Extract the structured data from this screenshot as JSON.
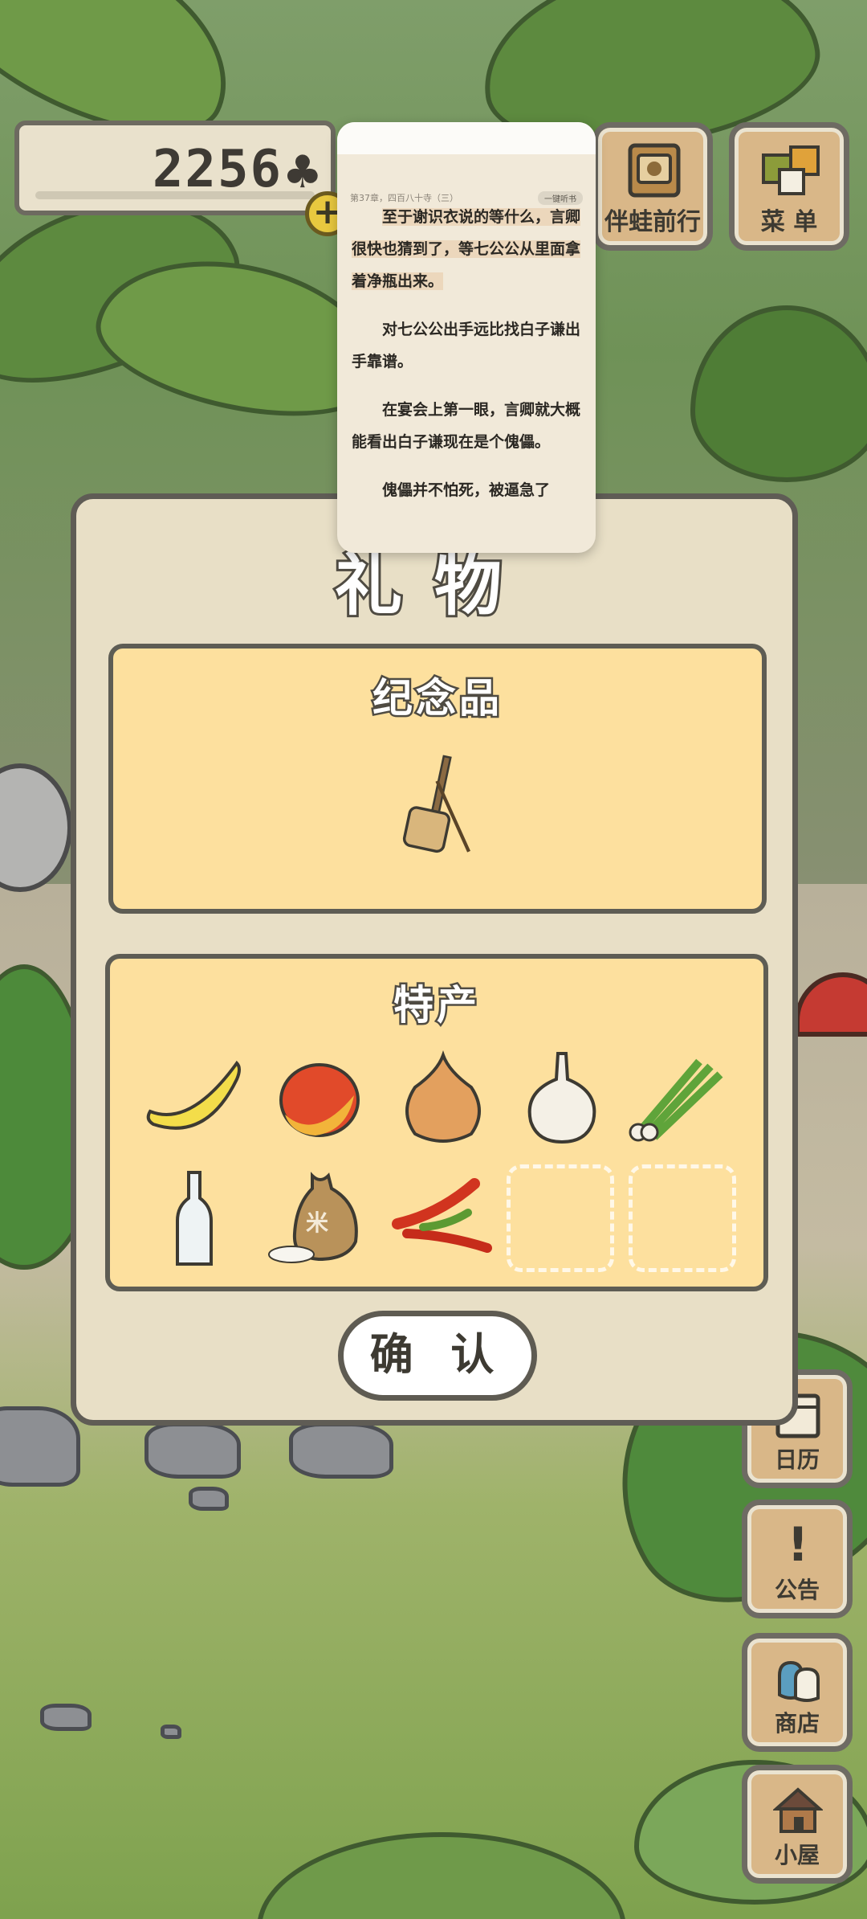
{
  "hud": {
    "clover_count": "2256",
    "clover_icon": "clover-icon",
    "plus_icon": "plus-icon"
  },
  "top_buttons": [
    {
      "label": "伴蛙前行",
      "icon": "album-icon"
    },
    {
      "label": "菜 单",
      "icon": "menu-icon"
    }
  ],
  "side_buttons": [
    {
      "label": "日历",
      "icon": "calendar-icon"
    },
    {
      "label": "公告",
      "icon": "exclamation-icon",
      "glyph": "!"
    },
    {
      "label": "商店",
      "icon": "bags-icon"
    },
    {
      "label": "小屋",
      "icon": "house-icon"
    }
  ],
  "dialog": {
    "title": "礼物",
    "souvenir": {
      "title": "纪念品",
      "items": [
        {
          "name": "sanshin-icon"
        }
      ]
    },
    "specialty": {
      "title": "特产",
      "items": [
        {
          "name": "banana-icon"
        },
        {
          "name": "mango-icon"
        },
        {
          "name": "onion-icon"
        },
        {
          "name": "garlic-icon"
        },
        {
          "name": "green-onion-icon"
        },
        {
          "name": "bottle-icon"
        },
        {
          "name": "rice-sack-icon",
          "label": "米"
        },
        {
          "name": "chili-pepper-icon"
        }
      ],
      "empty_slots": 2
    },
    "confirm_label": "确 认"
  },
  "reader": {
    "chapter": "第37章，四百八十寺（三）",
    "pill": "一键听书",
    "paragraphs": [
      {
        "text": "至于谢识衣说的等什么，言卿很快也猜到了，等七公公从里面拿着净瓶出来。",
        "highlight": true
      },
      {
        "text": "对七公公出手远比找白子谦出手靠谱。"
      },
      {
        "text": "在宴会上第一眼，言卿就大概能看出白子谦现在是个傀儡。"
      },
      {
        "text": "傀儡并不怕死，被逼急了"
      }
    ]
  },
  "colors": {
    "panel": "#fde09e",
    "dialog": "#e8dfc6",
    "outline": "#5e5d54",
    "button_wood": "#d9b788"
  }
}
